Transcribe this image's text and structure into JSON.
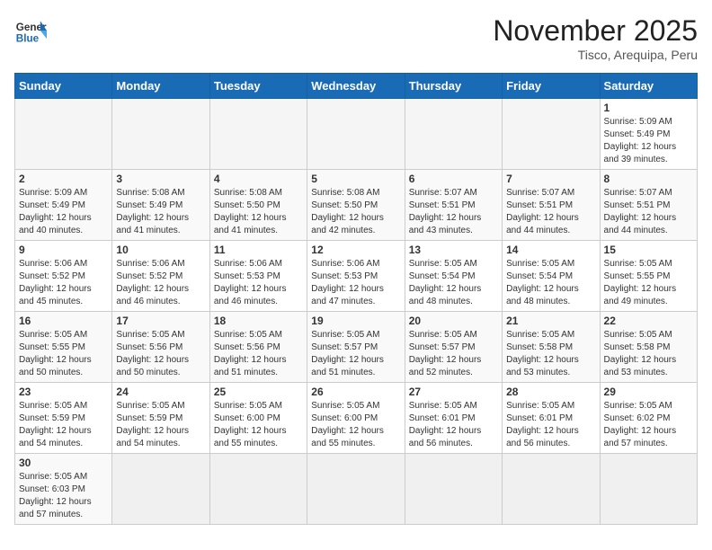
{
  "header": {
    "logo_general": "General",
    "logo_blue": "Blue",
    "month_title": "November 2025",
    "location": "Tisco, Arequipa, Peru"
  },
  "weekdays": [
    "Sunday",
    "Monday",
    "Tuesday",
    "Wednesday",
    "Thursday",
    "Friday",
    "Saturday"
  ],
  "weeks": [
    [
      {
        "day": null
      },
      {
        "day": null
      },
      {
        "day": null
      },
      {
        "day": null
      },
      {
        "day": null
      },
      {
        "day": null
      },
      {
        "day": "1",
        "sunrise": "5:09 AM",
        "sunset": "5:49 PM",
        "daylight": "12 hours and 39 minutes."
      }
    ],
    [
      {
        "day": "2",
        "sunrise": "5:09 AM",
        "sunset": "5:49 PM",
        "daylight": "12 hours and 40 minutes."
      },
      {
        "day": "3",
        "sunrise": "5:08 AM",
        "sunset": "5:49 PM",
        "daylight": "12 hours and 41 minutes."
      },
      {
        "day": "4",
        "sunrise": "5:08 AM",
        "sunset": "5:50 PM",
        "daylight": "12 hours and 41 minutes."
      },
      {
        "day": "5",
        "sunrise": "5:08 AM",
        "sunset": "5:50 PM",
        "daylight": "12 hours and 42 minutes."
      },
      {
        "day": "6",
        "sunrise": "5:07 AM",
        "sunset": "5:51 PM",
        "daylight": "12 hours and 43 minutes."
      },
      {
        "day": "7",
        "sunrise": "5:07 AM",
        "sunset": "5:51 PM",
        "daylight": "12 hours and 44 minutes."
      },
      {
        "day": "8",
        "sunrise": "5:07 AM",
        "sunset": "5:51 PM",
        "daylight": "12 hours and 44 minutes."
      }
    ],
    [
      {
        "day": "9",
        "sunrise": "5:06 AM",
        "sunset": "5:52 PM",
        "daylight": "12 hours and 45 minutes."
      },
      {
        "day": "10",
        "sunrise": "5:06 AM",
        "sunset": "5:52 PM",
        "daylight": "12 hours and 46 minutes."
      },
      {
        "day": "11",
        "sunrise": "5:06 AM",
        "sunset": "5:53 PM",
        "daylight": "12 hours and 46 minutes."
      },
      {
        "day": "12",
        "sunrise": "5:06 AM",
        "sunset": "5:53 PM",
        "daylight": "12 hours and 47 minutes."
      },
      {
        "day": "13",
        "sunrise": "5:05 AM",
        "sunset": "5:54 PM",
        "daylight": "12 hours and 48 minutes."
      },
      {
        "day": "14",
        "sunrise": "5:05 AM",
        "sunset": "5:54 PM",
        "daylight": "12 hours and 48 minutes."
      },
      {
        "day": "15",
        "sunrise": "5:05 AM",
        "sunset": "5:55 PM",
        "daylight": "12 hours and 49 minutes."
      }
    ],
    [
      {
        "day": "16",
        "sunrise": "5:05 AM",
        "sunset": "5:55 PM",
        "daylight": "12 hours and 50 minutes."
      },
      {
        "day": "17",
        "sunrise": "5:05 AM",
        "sunset": "5:56 PM",
        "daylight": "12 hours and 50 minutes."
      },
      {
        "day": "18",
        "sunrise": "5:05 AM",
        "sunset": "5:56 PM",
        "daylight": "12 hours and 51 minutes."
      },
      {
        "day": "19",
        "sunrise": "5:05 AM",
        "sunset": "5:57 PM",
        "daylight": "12 hours and 51 minutes."
      },
      {
        "day": "20",
        "sunrise": "5:05 AM",
        "sunset": "5:57 PM",
        "daylight": "12 hours and 52 minutes."
      },
      {
        "day": "21",
        "sunrise": "5:05 AM",
        "sunset": "5:58 PM",
        "daylight": "12 hours and 53 minutes."
      },
      {
        "day": "22",
        "sunrise": "5:05 AM",
        "sunset": "5:58 PM",
        "daylight": "12 hours and 53 minutes."
      }
    ],
    [
      {
        "day": "23",
        "sunrise": "5:05 AM",
        "sunset": "5:59 PM",
        "daylight": "12 hours and 54 minutes."
      },
      {
        "day": "24",
        "sunrise": "5:05 AM",
        "sunset": "5:59 PM",
        "daylight": "12 hours and 54 minutes."
      },
      {
        "day": "25",
        "sunrise": "5:05 AM",
        "sunset": "6:00 PM",
        "daylight": "12 hours and 55 minutes."
      },
      {
        "day": "26",
        "sunrise": "5:05 AM",
        "sunset": "6:00 PM",
        "daylight": "12 hours and 55 minutes."
      },
      {
        "day": "27",
        "sunrise": "5:05 AM",
        "sunset": "6:01 PM",
        "daylight": "12 hours and 56 minutes."
      },
      {
        "day": "28",
        "sunrise": "5:05 AM",
        "sunset": "6:01 PM",
        "daylight": "12 hours and 56 minutes."
      },
      {
        "day": "29",
        "sunrise": "5:05 AM",
        "sunset": "6:02 PM",
        "daylight": "12 hours and 57 minutes."
      }
    ],
    [
      {
        "day": "30",
        "sunrise": "5:05 AM",
        "sunset": "6:03 PM",
        "daylight": "12 hours and 57 minutes."
      },
      {
        "day": null
      },
      {
        "day": null
      },
      {
        "day": null
      },
      {
        "day": null
      },
      {
        "day": null
      },
      {
        "day": null
      }
    ]
  ]
}
